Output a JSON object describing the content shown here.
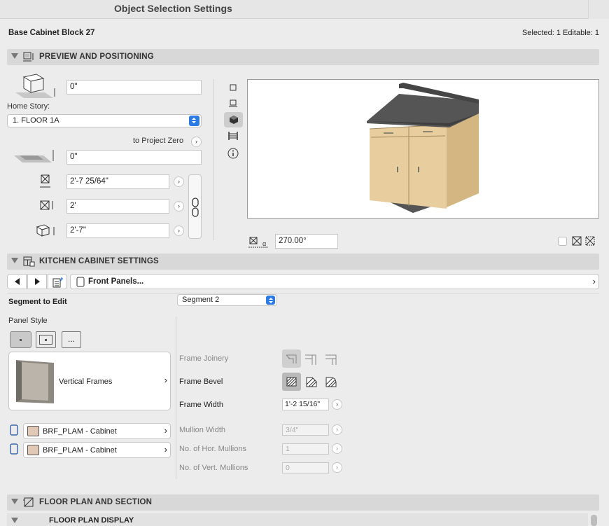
{
  "window": {
    "title": "Object Selection Settings"
  },
  "header": {
    "object_name": "Base Cabinet Block 27",
    "selection_status": "Selected: 1 Editable: 1"
  },
  "preview_section": {
    "title": "PREVIEW AND POSITIONING",
    "elevation_value": "0\"",
    "home_story_label": "Home Story:",
    "home_story_value": "1. FLOOR 1A",
    "to_project_zero_label": "to Project Zero",
    "project_zero_value": "0\"",
    "width_value": "2'-7 25/64\"",
    "depth_value": "2'",
    "height_value": "2'-7\"",
    "rotation_value": "270.00°"
  },
  "kitchen_section": {
    "title": "KITCHEN CABINET SETTINGS",
    "nav_page": "Front Panels...",
    "segment_label": "Segment to Edit",
    "segment_value": "Segment 2",
    "panel_style_label": "Panel Style",
    "panel_style_extra": "...",
    "panel_preview_label": "Vertical Frames",
    "materials": [
      "BRF_PLAM - Cabinet",
      "BRF_PLAM - Cabinet"
    ],
    "frame_joinery_label": "Frame Joinery",
    "frame_bevel_label": "Frame Bevel",
    "frame_width_label": "Frame Width",
    "frame_width_value": "1'-2 15/16\"",
    "mullion_width_label": "Mullion Width",
    "mullion_width_value": "3/4\"",
    "hor_mullions_label": "No. of Hor. Mullions",
    "hor_mullions_value": "1",
    "vert_mullions_label": "No. of Vert. Mullions",
    "vert_mullions_value": "0"
  },
  "floorplan_section": {
    "title": "FLOOR PLAN AND SECTION",
    "sub_title": "FLOOR PLAN DISPLAY"
  },
  "colors": {
    "accent": "#2c7be5",
    "section_bg": "#d8d8d8",
    "countertop": "#5a5a5a",
    "wood": "#e3c79a"
  }
}
